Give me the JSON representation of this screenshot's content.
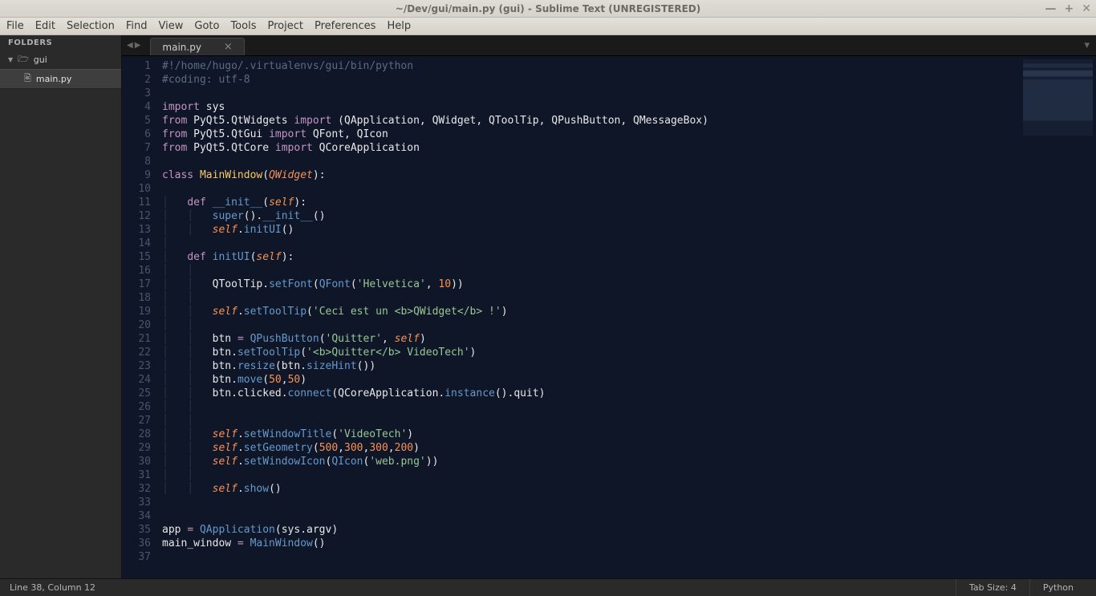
{
  "window": {
    "title": "~/Dev/gui/main.py (gui) - Sublime Text (UNREGISTERED)"
  },
  "menu": [
    "File",
    "Edit",
    "Selection",
    "Find",
    "View",
    "Goto",
    "Tools",
    "Project",
    "Preferences",
    "Help"
  ],
  "sidebar": {
    "header": "FOLDERS",
    "folder": "gui",
    "file": "main.py"
  },
  "tab": {
    "name": "main.py"
  },
  "status": {
    "position": "Line 38, Column 12",
    "tabsize": "Tab Size: 4",
    "syntax": "Python"
  },
  "code": {
    "lines": [
      {
        "n": 1,
        "h": "<span class='cm'>#!/home/hugo/.virtualenvs/gui/bin/python</span>"
      },
      {
        "n": 2,
        "h": "<span class='cm'>#coding: utf-8</span>"
      },
      {
        "n": 3,
        "h": ""
      },
      {
        "n": 4,
        "h": "<span class='kw'>import</span> sys"
      },
      {
        "n": 5,
        "h": "<span class='kw'>from</span> PyQt5.QtWidgets <span class='kw'>import</span> (QApplication, QWidget, QToolTip, QPushButton, QMessageBox)"
      },
      {
        "n": 6,
        "h": "<span class='kw'>from</span> PyQt5.QtGui <span class='kw'>import</span> QFont, QIcon"
      },
      {
        "n": 7,
        "h": "<span class='kw'>from</span> PyQt5.QtCore <span class='kw'>import</span> QCoreApplication"
      },
      {
        "n": 8,
        "h": ""
      },
      {
        "n": 9,
        "h": "<span class='kw'>class</span> <span class='cls'>MainWindow</span>(<span class='par'>QWidget</span>):"
      },
      {
        "n": 10,
        "h": ""
      },
      {
        "n": 11,
        "h": "<span class='indent-guide'>│   </span><span class='kw'>def</span> <span class='fn'>__init__</span>(<span class='self'>self</span>):"
      },
      {
        "n": 12,
        "h": "<span class='indent-guide'>│   │   </span><span class='builtin'>super</span>().<span class='fn'>__init__</span>()"
      },
      {
        "n": 13,
        "h": "<span class='indent-guide'>│   │   </span><span class='self'>self</span>.<span class='fn'>initUI</span>()"
      },
      {
        "n": 14,
        "h": "<span class='indent-guide'>│</span>"
      },
      {
        "n": 15,
        "h": "<span class='indent-guide'>│   </span><span class='kw'>def</span> <span class='fn'>initUI</span>(<span class='self'>self</span>):"
      },
      {
        "n": 16,
        "h": "<span class='indent-guide'>│   │</span>"
      },
      {
        "n": 17,
        "h": "<span class='indent-guide'>│   │   </span>QToolTip.<span class='fn'>setFont</span>(<span class='fn'>QFont</span>(<span class='st'>'Helvetica'</span>, <span class='nm'>10</span>))"
      },
      {
        "n": 18,
        "h": "<span class='indent-guide'>│   │</span>"
      },
      {
        "n": 19,
        "h": "<span class='indent-guide'>│   │   </span><span class='self'>self</span>.<span class='fn'>setToolTip</span>(<span class='st'>'Ceci est un &lt;b&gt;QWidget&lt;/b&gt; !'</span>)"
      },
      {
        "n": 20,
        "h": "<span class='indent-guide'>│   │</span>"
      },
      {
        "n": 21,
        "h": "<span class='indent-guide'>│   │   </span>btn <span class='op'>=</span> <span class='fn'>QPushButton</span>(<span class='st'>'Quitter'</span>, <span class='self'>self</span>)"
      },
      {
        "n": 22,
        "h": "<span class='indent-guide'>│   │   </span>btn.<span class='fn'>setToolTip</span>(<span class='st'>'&lt;b&gt;Quitter&lt;/b&gt; VideoTech'</span>)"
      },
      {
        "n": 23,
        "h": "<span class='indent-guide'>│   │   </span>btn.<span class='fn'>resize</span>(btn.<span class='fn'>sizeHint</span>())"
      },
      {
        "n": 24,
        "h": "<span class='indent-guide'>│   │   </span>btn.<span class='fn'>move</span>(<span class='nm'>50</span>,<span class='nm'>50</span>)"
      },
      {
        "n": 25,
        "h": "<span class='indent-guide'>│   │   </span>btn.clicked.<span class='fn'>connect</span>(QCoreApplication.<span class='fn'>instance</span>().quit)"
      },
      {
        "n": 26,
        "h": "<span class='indent-guide'>│   │</span>"
      },
      {
        "n": 27,
        "h": "<span class='indent-guide'>│   │</span>"
      },
      {
        "n": 28,
        "h": "<span class='indent-guide'>│   │   </span><span class='self'>self</span>.<span class='fn'>setWindowTitle</span>(<span class='st'>'VideoTech'</span>)"
      },
      {
        "n": 29,
        "h": "<span class='indent-guide'>│   │   </span><span class='self'>self</span>.<span class='fn'>setGeometry</span>(<span class='nm'>500</span>,<span class='nm'>300</span>,<span class='nm'>300</span>,<span class='nm'>200</span>)"
      },
      {
        "n": 30,
        "h": "<span class='indent-guide'>│   │   </span><span class='self'>self</span>.<span class='fn'>setWindowIcon</span>(<span class='fn'>QIcon</span>(<span class='st'>'web.png'</span>))"
      },
      {
        "n": 31,
        "h": "<span class='indent-guide'>│   │</span>"
      },
      {
        "n": 32,
        "h": "<span class='indent-guide'>│   │   </span><span class='self'>self</span>.<span class='fn'>show</span>()"
      },
      {
        "n": 33,
        "h": ""
      },
      {
        "n": 34,
        "h": ""
      },
      {
        "n": 35,
        "h": "app <span class='op'>=</span> <span class='fn'>QApplication</span>(sys.argv)"
      },
      {
        "n": 36,
        "h": "main_window <span class='op'>=</span> <span class='fn'>MainWindow</span>()"
      },
      {
        "n": 37,
        "h": ""
      }
    ]
  }
}
